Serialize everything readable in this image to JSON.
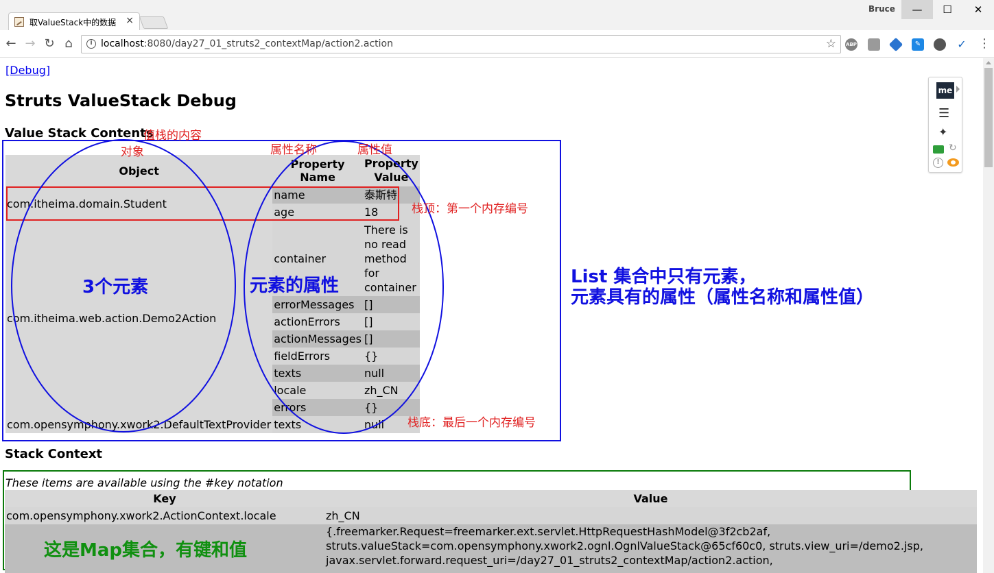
{
  "browser": {
    "tab_title": "取ValueStack中的数据",
    "tab_close": "×",
    "user_name": "Bruce",
    "win_min": "—",
    "win_max": "☐",
    "win_close": "✕",
    "url_host": "localhost",
    "url_rest": ":8080/day27_01_struts2_contextMap/action2.action",
    "ext_abp": "ABP",
    "ext_me": "me"
  },
  "page": {
    "debug_link": "[Debug]",
    "title": "Struts ValueStack Debug",
    "value_stack_heading": "Value Stack Contents",
    "stack_context_heading": "Stack Context"
  },
  "value_stack": {
    "headers": {
      "object": "Object",
      "property_name": "Property Name",
      "property_value": "Property Value"
    },
    "objects": [
      "com.itheima.domain.Student",
      "com.itheima.web.action.Demo2Action",
      "com.opensymphony.xwork2.DefaultTextProvider"
    ],
    "rows": [
      {
        "name": "name",
        "value": "泰斯特"
      },
      {
        "name": "age",
        "value": "18"
      },
      {
        "name": "container",
        "value": "There is no read method for container"
      },
      {
        "name": "errorMessages",
        "value": "[]"
      },
      {
        "name": "actionErrors",
        "value": "[]"
      },
      {
        "name": "actionMessages",
        "value": "[]"
      },
      {
        "name": "fieldErrors",
        "value": "{}"
      },
      {
        "name": "texts",
        "value": "null"
      },
      {
        "name": "locale",
        "value": "zh_CN"
      },
      {
        "name": "errors",
        "value": "{}"
      },
      {
        "name": "texts",
        "value": "null"
      }
    ]
  },
  "stack_context": {
    "note": "These items are available using the #key notation",
    "headers": {
      "key": "Key",
      "value": "Value"
    },
    "rows": [
      {
        "key": "com.opensymphony.xwork2.ActionContext.locale",
        "value": "zh_CN"
      },
      {
        "key": "",
        "value_lines": [
          "{.freemarker.Request=freemarker.ext.servlet.HttpRequestHashModel@3f2cb2af,",
          "struts.valueStack=com.opensymphony.xwork2.ognl.OgnlValueStack@65cf60c0, struts.view_uri=/demo2.jsp,",
          "javax.servlet.forward.request_uri=/day27_01_struts2_contextMap/action2.action,"
        ]
      }
    ]
  },
  "annotations": {
    "value_stack_label": "值栈的内容",
    "object_label": "对象",
    "prop_name_label": "属性名称",
    "prop_value_label": "属性值",
    "stack_top": "栈顶：第一个内存编号",
    "stack_bottom": "栈底：最后一个内存编号",
    "three_elements": "3个元素",
    "element_props": "元素的属性",
    "list_line1": "List 集合中只有元素，",
    "list_line2": "元素具有的属性（属性名称和属性值）",
    "map_label": "这是Map集合，有键和值"
  },
  "colors": {
    "annotation_red": "#e02020",
    "annotation_blue": "#1010e0",
    "annotation_green": "#109010",
    "link": "#0000ee"
  }
}
